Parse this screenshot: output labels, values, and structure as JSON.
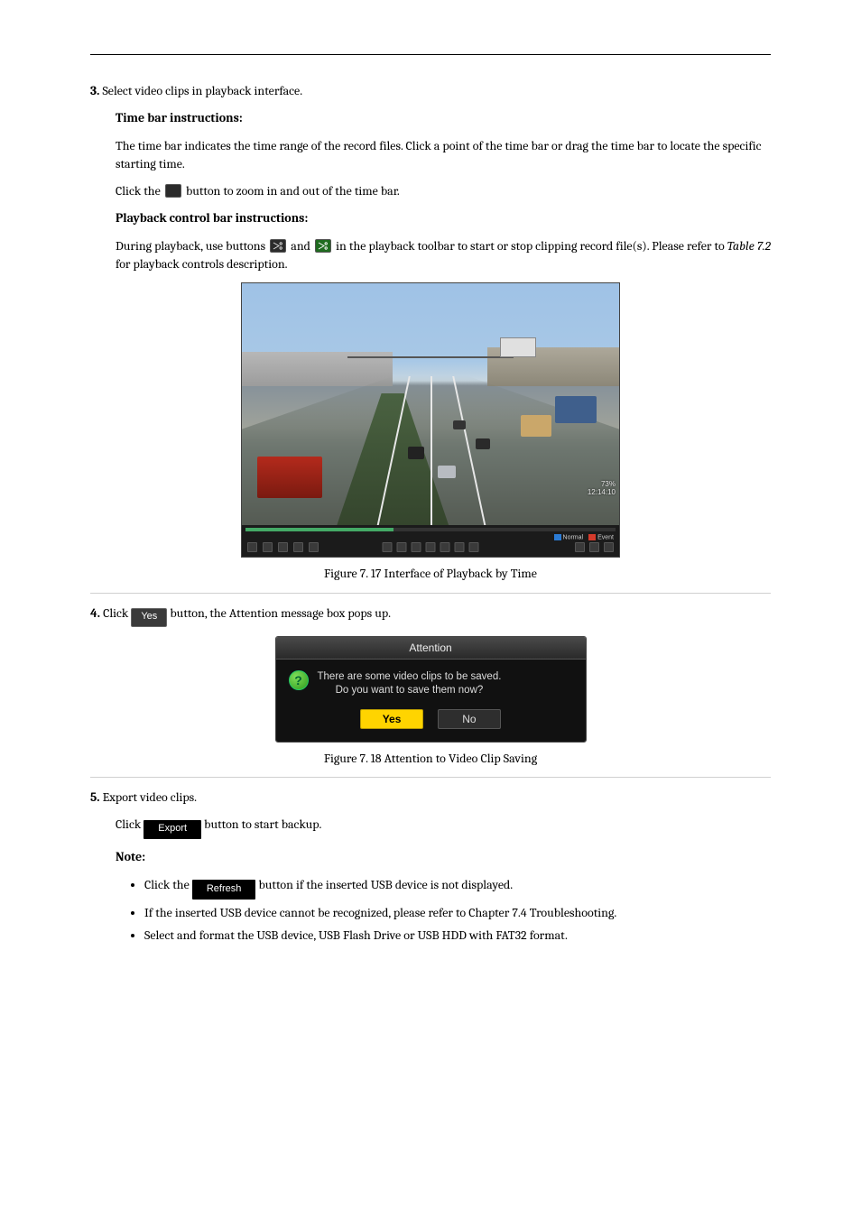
{
  "step3_intro": "Select video clips in playback interface.",
  "step3_bold": "3.",
  "step3_heading": "Time bar instructions:",
  "time_bar_1": "The time bar indicates the time range of the record files. Click a point of the time bar or drag the time bar to locate the specific starting time.",
  "time_bar_2": "Click the",
  "time_bar_2_b": "button to zoom in and out of the time bar.",
  "playback_bar_bold": "Playback control bar instructions:",
  "playback_bar_text": "During playback, use buttons",
  "playback_bar_text_mid": "and",
  "playback_bar_text_end": "in the playback toolbar to start or stop clipping record file(s). Please refer to",
  "playback_table_ref": "Table 7.2",
  "playback_bar_text_tail": "for playback controls description.",
  "overlay_pct": "73%",
  "overlay_time": "12:14:10",
  "legend_normal": "Normal",
  "legend_event": "Event",
  "caption_17": "Figure 7. 17 Interface of Playback by Time",
  "step4_bold": "4.",
  "step4_a": "Click",
  "step4_b": "button, the Attention message box pops up.",
  "yes_btn": "Yes",
  "attn_title": "Attention",
  "attn_line1": "There are some video clips to be saved.",
  "attn_line2": "Do you want to save them now?",
  "attn_yes": "Yes",
  "attn_no": "No",
  "caption_18": "Figure 7. 18 Attention to Video Clip Saving",
  "step5_bold": "5.",
  "step5_text": "Export video clips.",
  "export_click": "Click",
  "export_tail": "button to start backup.",
  "export_btn": "Export",
  "note_label": "Note:",
  "bullet1_a": "Click the",
  "bullet1_b": "button if the inserted USB device is not displayed.",
  "refresh_btn": "Refresh",
  "bullet2": "If the inserted USB device cannot be recognized, please refer to Chapter 7.4 Troubleshooting.",
  "bullet3": "Select and format the USB device, USB Flash Drive or USB HDD with FAT32 format."
}
